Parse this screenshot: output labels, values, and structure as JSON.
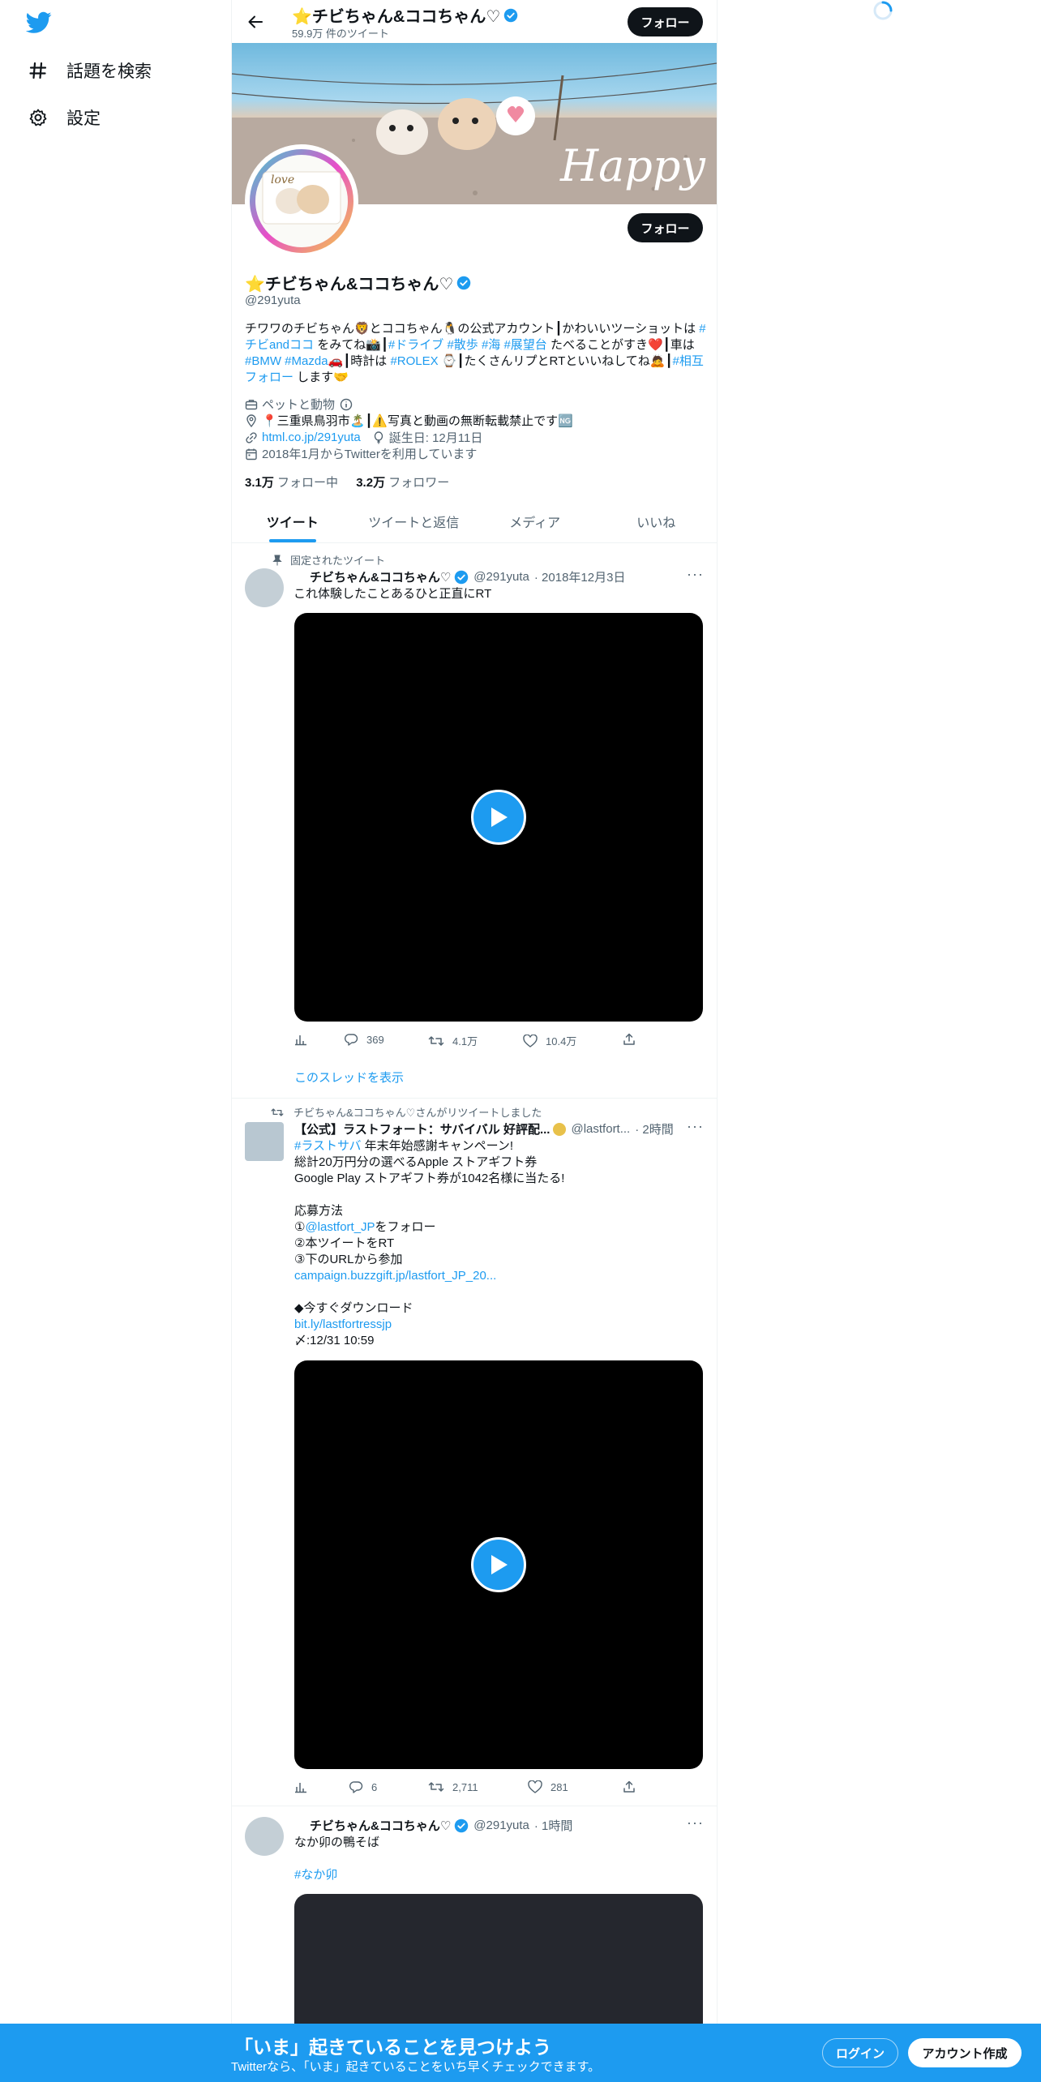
{
  "nav": {
    "explore_label": "話題を検索",
    "settings_label": "設定"
  },
  "header": {
    "name": "⭐チビちゃん&ココちゃん♡",
    "tweet_count": "59.9万 件のツイート",
    "follow_label": "フォロー"
  },
  "profile": {
    "name": "⭐チビちゃん&ココちゃん♡",
    "handle": "@291yuta",
    "follow_label": "フォロー",
    "bio": {
      "p1": "チワワのチビちゃん🦁とココちゃん🐧の公式アカウント┃かわいいツーショットは ",
      "tag1": "#チビandココ",
      "p2": " をみてね📸┃",
      "tag2": "#ドライブ",
      "tag3": "#散歩",
      "tag4": "#海",
      "tag5": "#展望台",
      "p3": " たべることがすき❤️┃車は ",
      "tag6": "#BMW",
      "tag7": "#Mazda",
      "p4": "🚗┃時計は ",
      "tag8": "#ROLEX",
      "p5": " ⌚┃たくさんリプとRTといいねしてね🙇┃",
      "tag9": "#相互フォロー",
      "p6": " します🤝"
    },
    "category": "ペットと動物",
    "location": "📍三重県鳥羽市🏝️┃⚠️写真と動画の無断転載禁止です🆖",
    "website": "html.co.jp/291yuta",
    "birthday": "誕生日: 12月11日",
    "joined": "2018年1月からTwitterを利用しています",
    "following_count": "3.1万",
    "following_label": "フォロー中",
    "followers_count": "3.2万",
    "followers_label": "フォロワー"
  },
  "tabs": [
    "ツイート",
    "ツイートと返信",
    "メディア",
    "いいね"
  ],
  "tweets": [
    {
      "context": "固定されたツイート",
      "name": "チビちゃん&ココちゃん♡",
      "handle": "@291yuta",
      "time": "· 2018年12月3日",
      "text": "これ体験したことあるひと正直にRT",
      "replies": "369",
      "retweets": "4.1万",
      "likes": "10.4万",
      "show_thread": "このスレッドを表示"
    },
    {
      "context": "チビちゃん&ココちゃん♡さんがリツイートしました",
      "name": "【公式】ラストフォート：サバイバル 好評配...",
      "handle": "@lastfort...",
      "time": "· 2時間",
      "hashtag": "#ラストサバ",
      "line1": " 年末年始感謝キャンペーン!",
      "line2": "総計20万円分の選べるApple ストアギフト券",
      "line3": "Google Play ストアギフト券が1042名様に当たる!",
      "line4": "応募方法",
      "line5a": "①",
      "mention": "@lastfort_JP",
      "line5b": "をフォロー",
      "line6": "②本ツイートをRT",
      "line7": "③下のURLから参加",
      "link1": "campaign.buzzgift.jp/lastfort_JP_20...",
      "line8": "◆今すぐダウンロード",
      "link2": "bit.ly/lastfortressjp",
      "line9": "〆:12/31 10:59",
      "replies": "6",
      "retweets": "2,711",
      "likes": "281"
    },
    {
      "name": "チビちゃん&ココちゃん♡",
      "handle": "@291yuta",
      "time": "· 1時間",
      "text": "なか卯の鴨そば",
      "hashtag": "#なか卯"
    }
  ],
  "bottom_bar": {
    "title": "「いま」起きていることを見つけよう",
    "subtitle": "Twitterなら、「いま」起きていることをいち早くチェックできます。",
    "login_label": "ログイン",
    "signup_label": "アカウント作成"
  },
  "colors": {
    "accent": "#1d9bf0",
    "text": "#0f1419",
    "secondary": "#536471"
  }
}
